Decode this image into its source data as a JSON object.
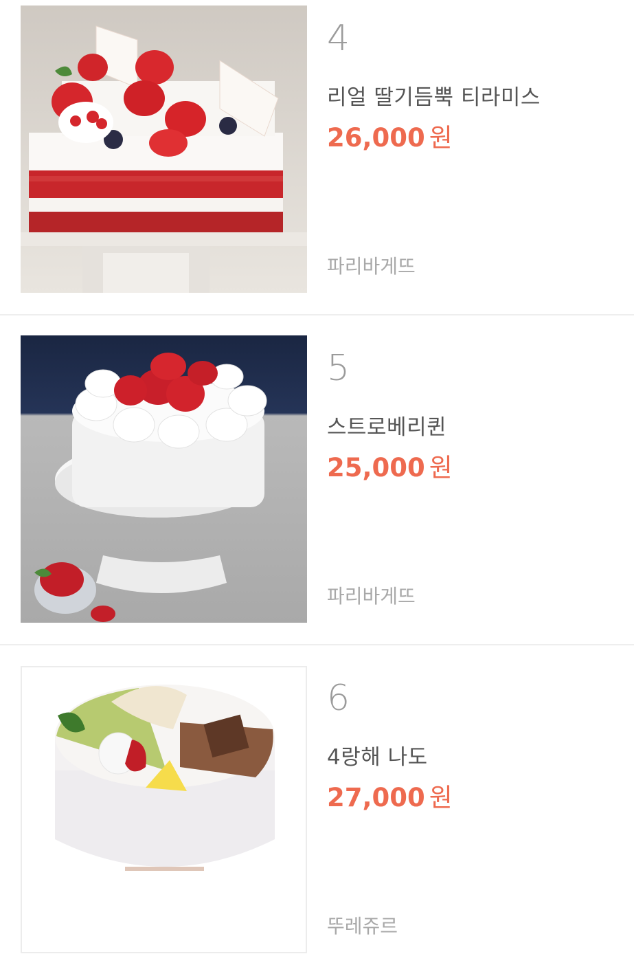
{
  "products": [
    {
      "rank": "4",
      "name": "리얼 딸기듬뿍 티라미스",
      "price": "26,000",
      "currency": "원",
      "brand": "파리바게뜨",
      "image": "strawberry-tiramisu-cake-photo"
    },
    {
      "rank": "5",
      "name": "스트로베리퀸",
      "price": "25,000",
      "currency": "원",
      "brand": "파리바게뜨",
      "image": "strawberry-queen-cake-photo"
    },
    {
      "rank": "6",
      "name": "4랑해 나도",
      "price": "27,000",
      "currency": "원",
      "brand": "뚜레쥬르",
      "image": "four-flavor-cake-photo"
    }
  ],
  "colors": {
    "price": "#ee6a4f",
    "rank": "#9b9b9b",
    "name": "#555555",
    "brand": "#a8a8a8",
    "divider": "#eeeeee"
  }
}
